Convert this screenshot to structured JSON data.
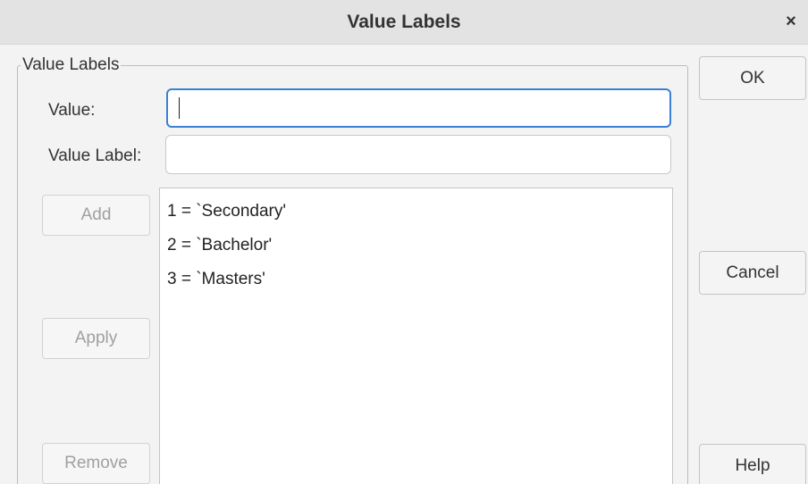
{
  "window": {
    "title": "Value Labels",
    "close_glyph": "×"
  },
  "group": {
    "title": "Value Labels",
    "value_label": "Value:",
    "value_input": "",
    "value_label_label": "Value Label:",
    "value_label_input": ""
  },
  "list": {
    "items": [
      "1 = `Secondary'",
      "2 = `Bachelor'",
      "3 = `Masters'"
    ]
  },
  "buttons": {
    "add": "Add",
    "apply": "Apply",
    "remove": "Remove",
    "ok": "OK",
    "cancel": "Cancel",
    "help": "Help"
  },
  "colors": {
    "focus_border": "#3b7fd6",
    "disabled_text": "#a0a0a0"
  }
}
